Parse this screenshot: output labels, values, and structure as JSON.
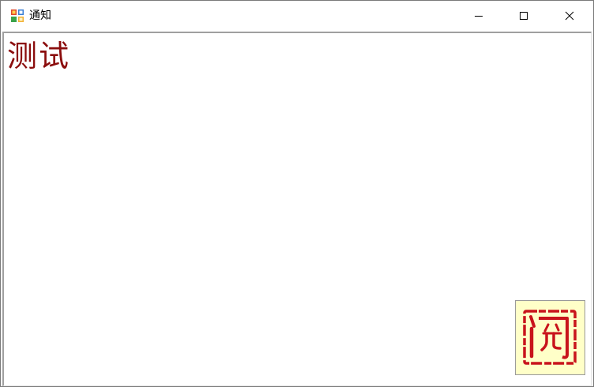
{
  "window": {
    "title": "通知",
    "controls": {
      "minimize_icon": "minimize-icon",
      "maximize_icon": "maximize-icon",
      "close_icon": "close-icon"
    }
  },
  "content": {
    "message": "测试",
    "message_color": "#8b0d0d",
    "stamp": {
      "char": "阅",
      "color": "#c8141c",
      "background": "#ffffc8"
    }
  }
}
